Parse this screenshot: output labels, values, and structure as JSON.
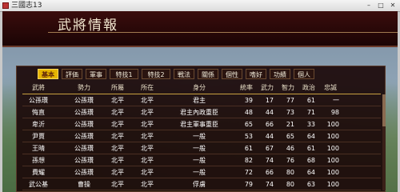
{
  "window": {
    "title": "三國志13",
    "min": "–",
    "max": "□",
    "close": "✕"
  },
  "panel_title": "武將情報",
  "tabs": [
    {
      "label": "基本",
      "active": true
    },
    {
      "label": "評価",
      "active": false
    },
    {
      "label": "軍事",
      "active": false
    },
    {
      "label": "特技1",
      "active": false
    },
    {
      "label": "特技2",
      "active": false
    },
    {
      "label": "戦法",
      "active": false
    },
    {
      "label": "關係",
      "active": false
    },
    {
      "label": "個性",
      "active": false
    },
    {
      "label": "嗜好",
      "active": false
    },
    {
      "label": "功績",
      "active": false
    },
    {
      "label": "個人",
      "active": false
    }
  ],
  "columns": [
    "武將",
    "勢力",
    "所屬",
    "所在",
    "身分",
    "統率",
    "武力",
    "智力",
    "政治",
    "忠誠"
  ],
  "rows": [
    {
      "name": "公孫瓚",
      "faction": "公孫瓚",
      "belong": "北平",
      "location": "北平",
      "status": "君主",
      "lead": "39",
      "war": "17",
      "int": "77",
      "pol": "61",
      "loyal": "一"
    },
    {
      "name": "悔直",
      "faction": "公孫瓚",
      "belong": "北平",
      "location": "北平",
      "status": "君主內政重臣",
      "lead": "48",
      "war": "44",
      "int": "73",
      "pol": "71",
      "loyal": "98"
    },
    {
      "name": "卑沂",
      "faction": "公孫瓚",
      "belong": "北平",
      "location": "北平",
      "status": "君主軍事重臣",
      "lead": "65",
      "war": "66",
      "int": "21",
      "pol": "33",
      "loyal": "100"
    },
    {
      "name": "尹賈",
      "faction": "公孫瓚",
      "belong": "北平",
      "location": "北平",
      "status": "一般",
      "lead": "53",
      "war": "44",
      "int": "65",
      "pol": "64",
      "loyal": "100"
    },
    {
      "name": "王晴",
      "faction": "公孫瓚",
      "belong": "北平",
      "location": "北平",
      "status": "一般",
      "lead": "61",
      "war": "67",
      "int": "46",
      "pol": "61",
      "loyal": "100"
    },
    {
      "name": "孫想",
      "faction": "公孫瓚",
      "belong": "北平",
      "location": "北平",
      "status": "一般",
      "lead": "82",
      "war": "74",
      "int": "76",
      "pol": "68",
      "loyal": "100"
    },
    {
      "name": "費耀",
      "faction": "公孫瓚",
      "belong": "北平",
      "location": "北平",
      "status": "一般",
      "lead": "72",
      "war": "66",
      "int": "80",
      "pol": "64",
      "loyal": "100"
    },
    {
      "name": "武公基",
      "faction": "曹操",
      "belong": "北平",
      "location": "北平",
      "status": "俘虜",
      "lead": "79",
      "war": "74",
      "int": "80",
      "pol": "63",
      "loyal": "100"
    }
  ]
}
